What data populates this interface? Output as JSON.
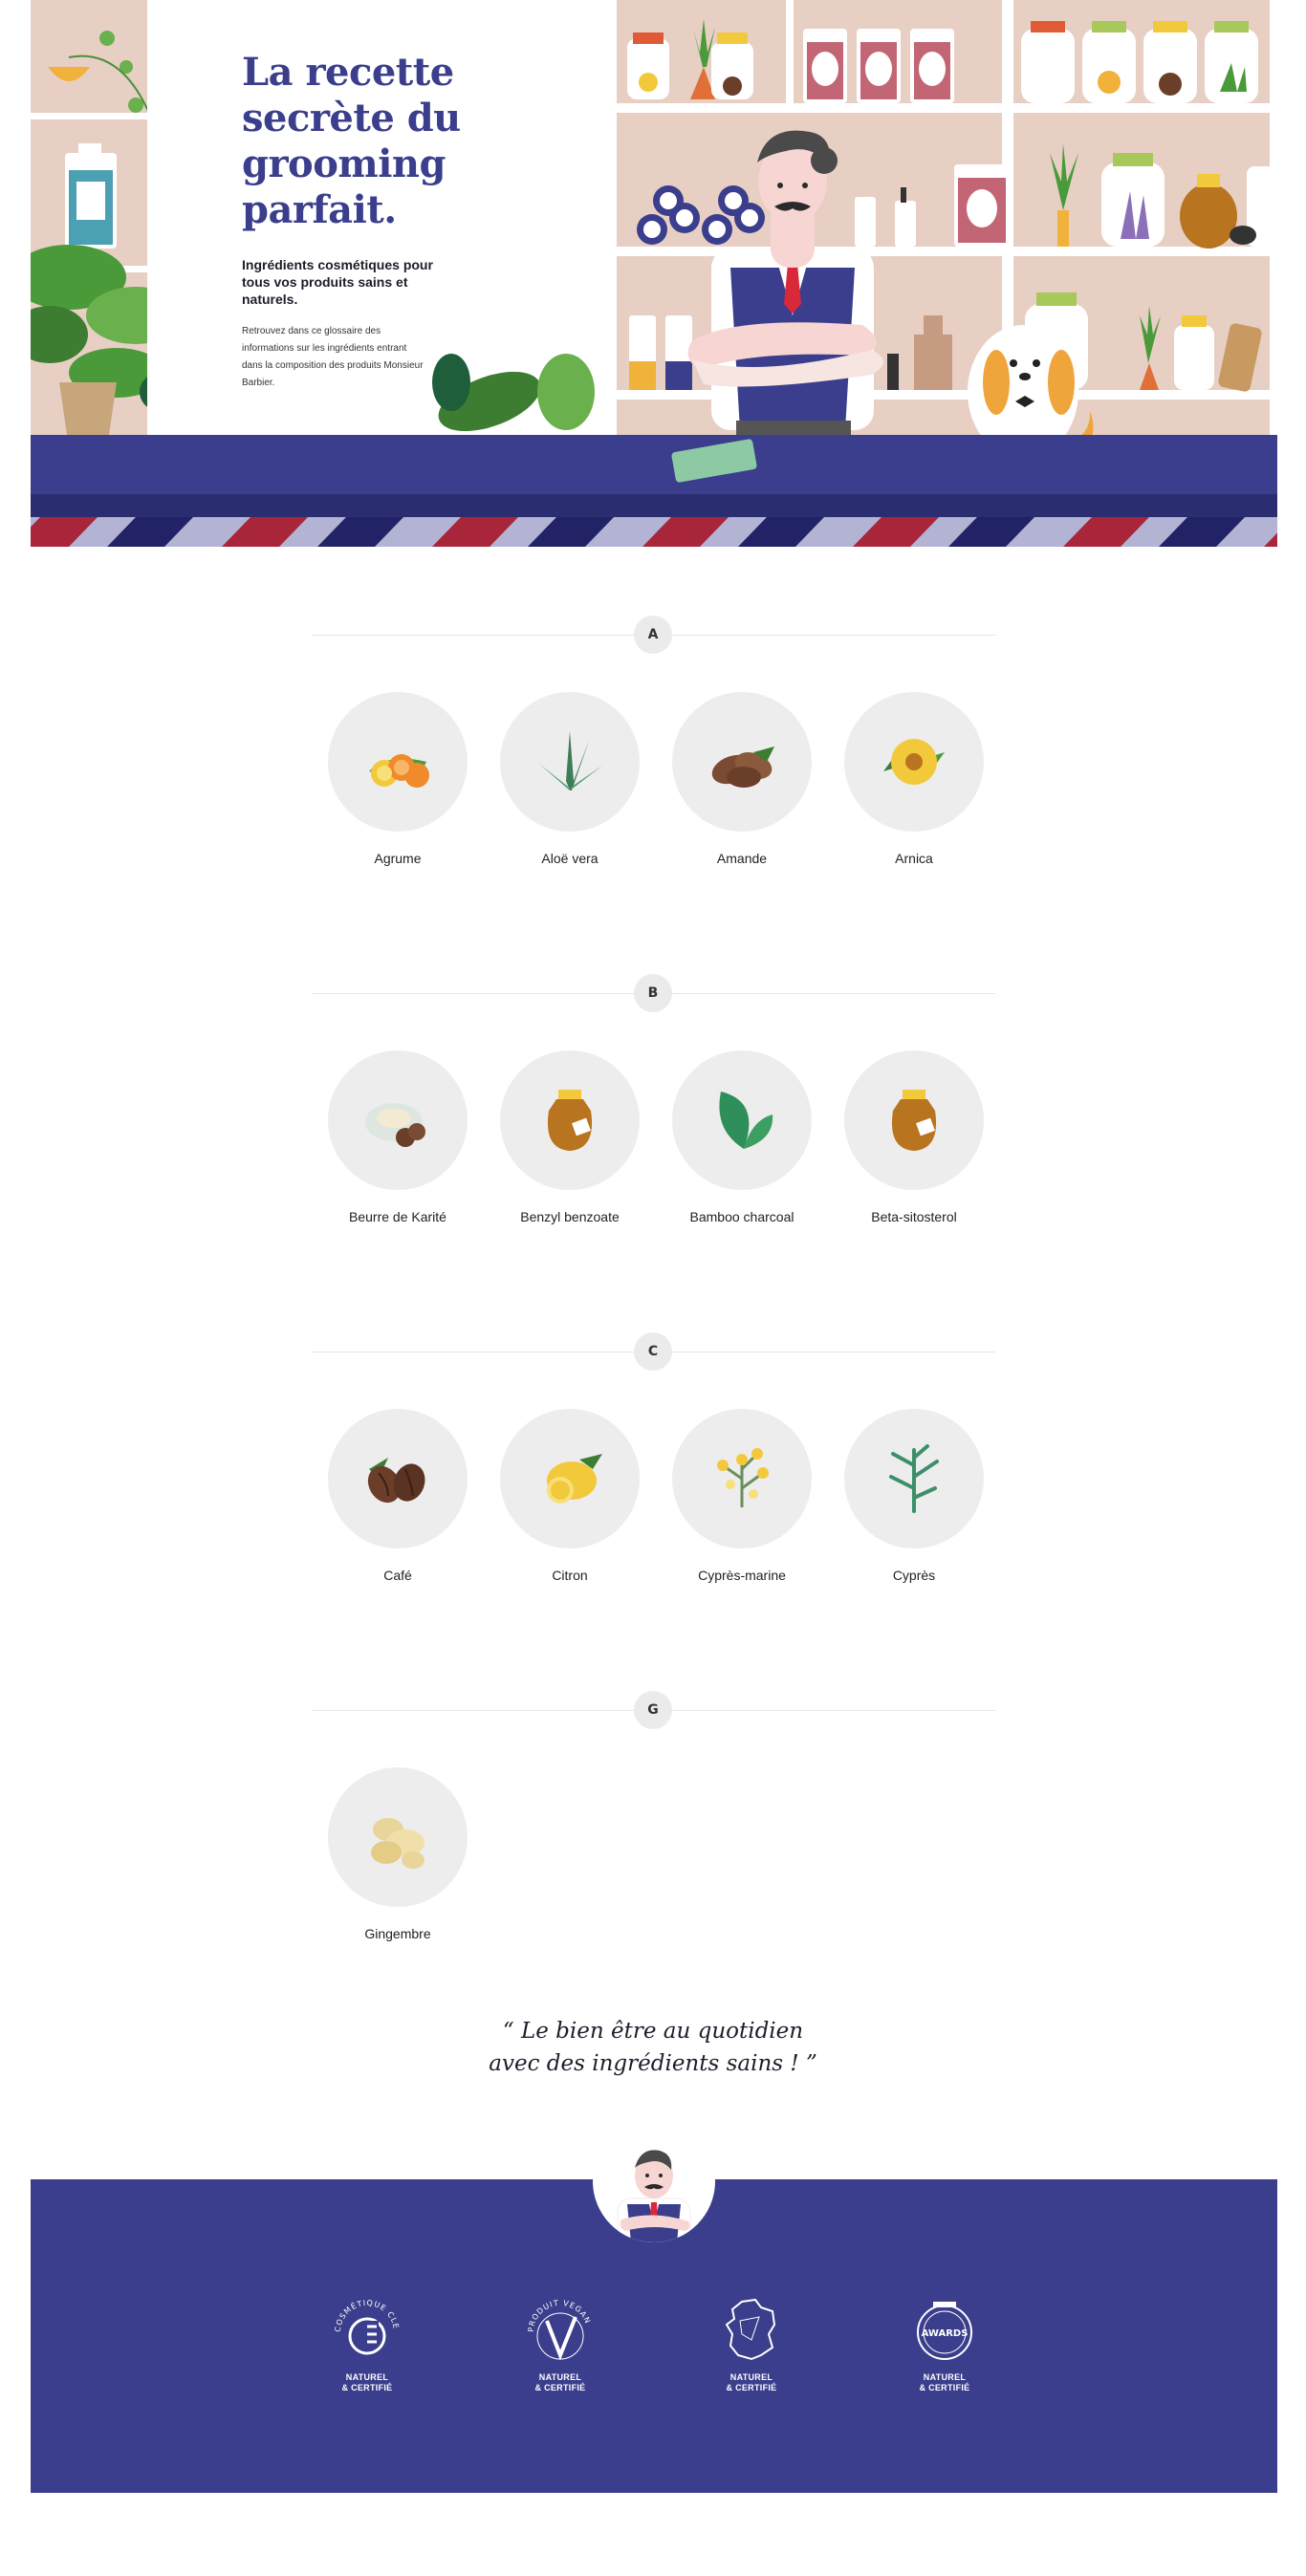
{
  "hero": {
    "title": "La recette secrète du grooming parfait.",
    "subtitle": "Ingrédients cosmétiques pour tous vos produits sains et naturels.",
    "description": "Retrouvez dans ce glossaire des informations sur les ingrédients entrant dans la composition des produits Monsieur Barbier."
  },
  "glossary": [
    {
      "letter": "A",
      "items": [
        {
          "name": "Agrume",
          "icon": "citrus-icon"
        },
        {
          "name": "Aloë vera",
          "icon": "aloe-vera-icon"
        },
        {
          "name": "Amande",
          "icon": "almond-icon"
        },
        {
          "name": "Arnica",
          "icon": "arnica-flower-icon"
        }
      ]
    },
    {
      "letter": "B",
      "items": [
        {
          "name": "Beurre de Karité",
          "icon": "shea-butter-icon"
        },
        {
          "name": "Benzyl benzoate",
          "icon": "jar-icon"
        },
        {
          "name": "Bamboo charcoal",
          "icon": "leaves-icon"
        },
        {
          "name": "Beta-sitosterol",
          "icon": "jar-icon"
        }
      ]
    },
    {
      "letter": "C",
      "items": [
        {
          "name": "Café",
          "icon": "coffee-beans-icon"
        },
        {
          "name": "Citron",
          "icon": "lemon-icon"
        },
        {
          "name": "Cyprès-marine",
          "icon": "sea-cypress-icon"
        },
        {
          "name": "Cyprès",
          "icon": "cypress-icon"
        }
      ]
    },
    {
      "letter": "G",
      "items": [
        {
          "name": "Gingembre",
          "icon": "ginger-icon"
        }
      ]
    }
  ],
  "quote": {
    "line1": "“ Le bien être au quotidien",
    "line2": "avec des ingrédients sains ! ”"
  },
  "footer": {
    "badges": [
      {
        "ring": "COSMÉTIQUE CLEAN",
        "caption1": "NATUREL",
        "caption2": "& CERTIFIÉ",
        "icon": "clean-cosmetic-icon"
      },
      {
        "ring": "PRODUIT VEGAN",
        "caption1": "NATUREL",
        "caption2": "& CERTIFIÉ",
        "icon": "vegan-icon"
      },
      {
        "ring": "",
        "caption1": "NATUREL",
        "caption2": "& CERTIFIÉ",
        "icon": "france-map-icon"
      },
      {
        "ring": "AWARDS",
        "caption1": "NATUREL",
        "caption2": "& CERTIFIÉ",
        "icon": "awards-icon"
      }
    ]
  },
  "colors": {
    "brand_blue": "#3a3e8c",
    "circle_bg": "#ededed",
    "shelf_bg": "#e7cfc4",
    "barber_red": "#a8253a",
    "barber_lavender": "#b3b3d4"
  }
}
